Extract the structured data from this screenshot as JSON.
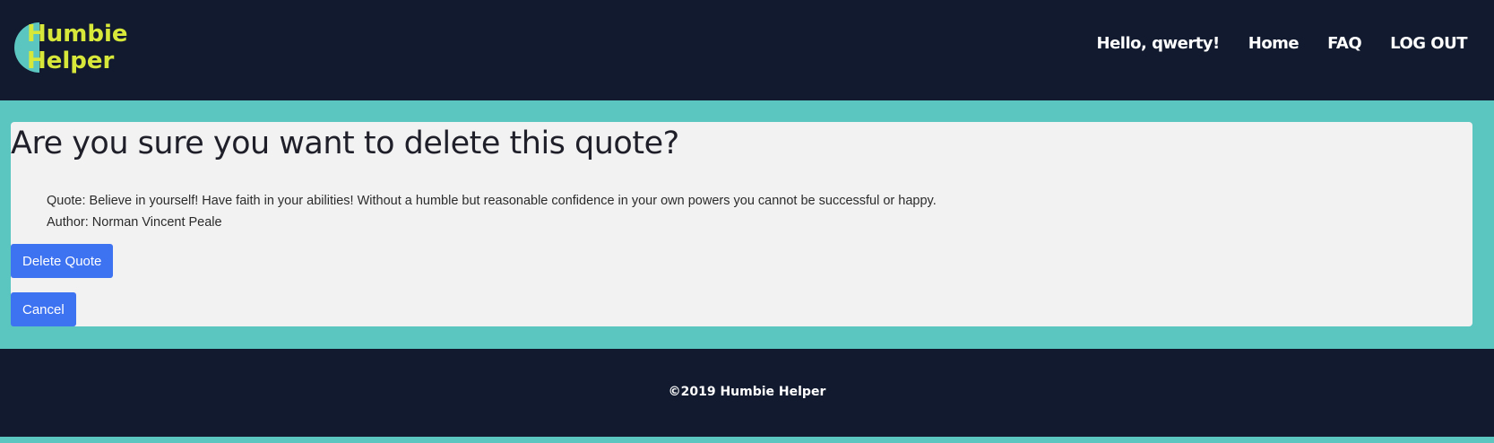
{
  "brand": {
    "line1": "Humbie",
    "line2": "Helper"
  },
  "nav": {
    "greeting": "Hello, qwerty!",
    "home": "Home",
    "faq": "FAQ",
    "logout": "LOG OUT"
  },
  "main": {
    "heading": "Are you sure you want to delete this quote?",
    "quote_line": "Quote: Believe in yourself! Have faith in your abilities! Without a humble but reasonable confidence in your own powers you cannot be successful or happy.",
    "author_line": "Author: Norman Vincent Peale",
    "delete_label": "Delete Quote",
    "cancel_label": "Cancel"
  },
  "footer": {
    "copyright": "©2019 Humbie Helper"
  },
  "colors": {
    "navbar_bg": "#111a2e",
    "page_bg": "#5bc5c0",
    "logo_text": "#d8e83a",
    "button_bg": "#3d72f0",
    "card_bg": "#f2f2f2"
  }
}
